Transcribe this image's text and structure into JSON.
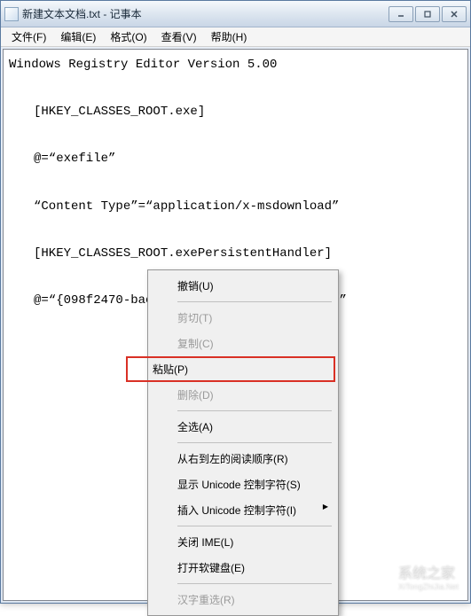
{
  "titlebar": {
    "text": "新建文本文档.txt - 记事本"
  },
  "menubar": {
    "file": "文件(F)",
    "edit": "编辑(E)",
    "format": "格式(O)",
    "view": "查看(V)",
    "help": "帮助(H)"
  },
  "content": {
    "line1": "Windows Registry Editor Version 5.00",
    "line2": "　　[HKEY_CLASSES_ROOT.exe]",
    "line3": "　　@=“exefile”",
    "line4": "　　“Content Type”=“application/x-msdownload”",
    "line5": "　　[HKEY_CLASSES_ROOT.exePersistentHandler]",
    "line6": "　　@=“{098f2470-bae0-11cd-b579-08002b30bfeb}”"
  },
  "context_menu": {
    "undo": "撤销(U)",
    "cut": "剪切(T)",
    "copy": "复制(C)",
    "paste": "粘贴(P)",
    "delete": "删除(D)",
    "select_all": "全选(A)",
    "rtl_reading": "从右到左的阅读顺序(R)",
    "show_unicode": "显示 Unicode 控制字符(S)",
    "insert_unicode": "插入 Unicode 控制字符(I)",
    "close_ime": "关闭 IME(L)",
    "open_soft_keyboard": "打开软键盘(E)",
    "hanzi_reselect": "汉字重选(R)"
  },
  "watermark": {
    "text": "系统之家",
    "sub": "XiTongZhiJia.Net"
  }
}
